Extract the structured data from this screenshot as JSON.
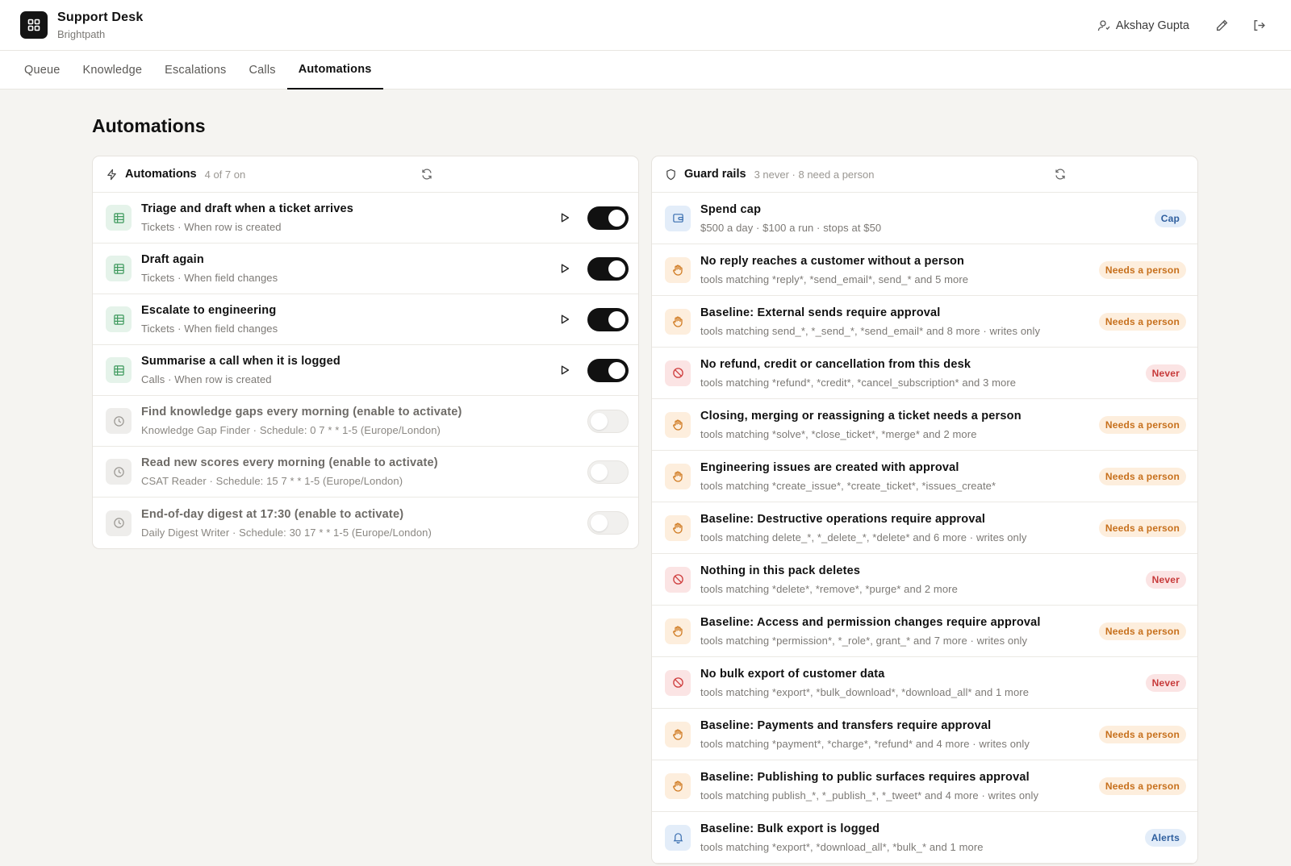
{
  "app": {
    "title": "Support Desk",
    "org": "Brightpath"
  },
  "user": {
    "name": "Akshay Gupta"
  },
  "tabs": [
    {
      "label": "Queue"
    },
    {
      "label": "Knowledge"
    },
    {
      "label": "Escalations"
    },
    {
      "label": "Calls"
    },
    {
      "label": "Automations",
      "active": true
    }
  ],
  "page": {
    "title": "Automations"
  },
  "automations": {
    "title": "Automations",
    "summary": "4 of 7 on",
    "items": [
      {
        "title": "Triage and draft when a ticket arrives",
        "sub": "Tickets · When row is created",
        "icon": "table-icon",
        "enabled": true
      },
      {
        "title": "Draft again",
        "sub": "Tickets · When field changes",
        "icon": "table-icon",
        "enabled": true
      },
      {
        "title": "Escalate to engineering",
        "sub": "Tickets · When field changes",
        "icon": "table-icon",
        "enabled": true
      },
      {
        "title": "Summarise a call when it is logged",
        "sub": "Calls · When row is created",
        "icon": "table-icon",
        "enabled": true
      },
      {
        "title": "Find knowledge gaps every morning (enable to activate)",
        "sub": "Knowledge Gap Finder · Schedule: 0 7 * * 1-5 (Europe/London)",
        "icon": "clock-icon",
        "enabled": false
      },
      {
        "title": "Read new scores every morning (enable to activate)",
        "sub": "CSAT Reader · Schedule: 15 7 * * 1-5 (Europe/London)",
        "icon": "clock-icon",
        "enabled": false
      },
      {
        "title": "End-of-day digest at 17:30 (enable to activate)",
        "sub": "Daily Digest Writer · Schedule: 30 17 * * 1-5 (Europe/London)",
        "icon": "clock-icon",
        "enabled": false
      }
    ]
  },
  "guardrails": {
    "title": "Guard rails",
    "summary": "3 never · 8 need a person",
    "items": [
      {
        "title": "Spend cap",
        "sub": "$500 a day · $100 a run · stops at $50",
        "kind": "cap",
        "badge": "Cap",
        "icon": "wallet-icon"
      },
      {
        "title": "No reply reaches a customer without a person",
        "sub": "tools matching *reply*, *send_email*, send_* and 5 more",
        "kind": "needs",
        "badge": "Needs a person",
        "icon": "hand-icon"
      },
      {
        "title": "Baseline: External sends require approval",
        "sub": "tools matching send_*, *_send_*, *send_email* and 8 more · writes only",
        "kind": "needs",
        "badge": "Needs a person",
        "icon": "hand-icon"
      },
      {
        "title": "No refund, credit or cancellation from this desk",
        "sub": "tools matching *refund*, *credit*, *cancel_subscription* and 3 more",
        "kind": "never",
        "badge": "Never",
        "icon": "ban-icon"
      },
      {
        "title": "Closing, merging or reassigning a ticket needs a person",
        "sub": "tools matching *solve*, *close_ticket*, *merge* and 2 more",
        "kind": "needs",
        "badge": "Needs a person",
        "icon": "hand-icon"
      },
      {
        "title": "Engineering issues are created with approval",
        "sub": "tools matching *create_issue*, *create_ticket*, *issues_create*",
        "kind": "needs",
        "badge": "Needs a person",
        "icon": "hand-icon"
      },
      {
        "title": "Baseline: Destructive operations require approval",
        "sub": "tools matching delete_*, *_delete_*, *delete* and 6 more · writes only",
        "kind": "needs",
        "badge": "Needs a person",
        "icon": "hand-icon"
      },
      {
        "title": "Nothing in this pack deletes",
        "sub": "tools matching *delete*, *remove*, *purge* and 2 more",
        "kind": "never",
        "badge": "Never",
        "icon": "ban-icon"
      },
      {
        "title": "Baseline: Access and permission changes require approval",
        "sub": "tools matching *permission*, *_role*, grant_* and 7 more · writes only",
        "kind": "needs",
        "badge": "Needs a person",
        "icon": "hand-icon"
      },
      {
        "title": "No bulk export of customer data",
        "sub": "tools matching *export*, *bulk_download*, *download_all* and 1 more",
        "kind": "never",
        "badge": "Never",
        "icon": "ban-icon"
      },
      {
        "title": "Baseline: Payments and transfers require approval",
        "sub": "tools matching *payment*, *charge*, *refund* and 4 more · writes only",
        "kind": "needs",
        "badge": "Needs a person",
        "icon": "hand-icon"
      },
      {
        "title": "Baseline: Publishing to public surfaces requires approval",
        "sub": "tools matching publish_*, *_publish_*, *_tweet* and 4 more · writes only",
        "kind": "needs",
        "badge": "Needs a person",
        "icon": "hand-icon"
      },
      {
        "title": "Baseline: Bulk export is logged",
        "sub": "tools matching *export*, *download_all*, *bulk_* and 1 more",
        "kind": "alerts",
        "badge": "Alerts",
        "icon": "bell-icon"
      }
    ]
  }
}
